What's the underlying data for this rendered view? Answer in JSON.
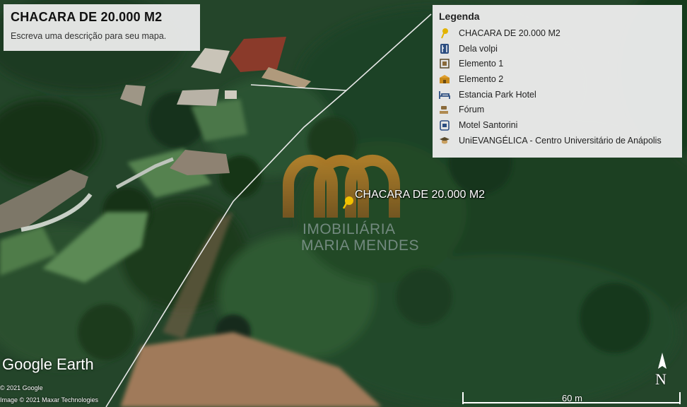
{
  "title": "CHACARA DE 20.000 M2",
  "description": "Escreva uma descrição para seu mapa.",
  "legend": {
    "title": "Legenda",
    "items": [
      {
        "label": "CHACARA DE 20.000 M2",
        "icon": "pushpin-icon"
      },
      {
        "label": "Dela volpi",
        "icon": "restaurant-icon"
      },
      {
        "label": "Elemento 1",
        "icon": "square-icon"
      },
      {
        "label": "Elemento 2",
        "icon": "building-icon"
      },
      {
        "label": "Estancia Park Hotel",
        "icon": "bed-icon"
      },
      {
        "label": "Fórum",
        "icon": "gavel-icon"
      },
      {
        "label": "Motel Santorini",
        "icon": "motel-icon"
      },
      {
        "label": "UniEVANGÉLICA - Centro Universitário de Anápolis",
        "icon": "graduation-cap-icon"
      }
    ]
  },
  "placemark_label": "CHACARA DE 20.000 M2",
  "watermark": {
    "line1": "IMOBILIÁRIA",
    "line2": "MARIA MENDES"
  },
  "brand": "Google Earth",
  "copyright": [
    "© 2021 Google",
    "Image © 2021 Maxar Technologies"
  ],
  "scale": "60 m",
  "compass": "N",
  "colors": {
    "accent": "#d8a000",
    "legend_icon": "#2b4d80"
  }
}
